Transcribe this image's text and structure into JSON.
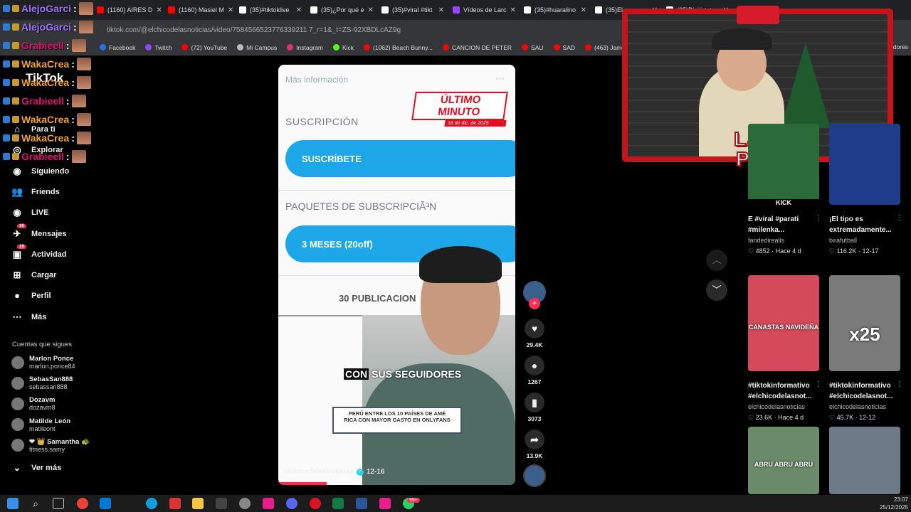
{
  "browser": {
    "tabs": [
      {
        "title": "(1160) AIRES D",
        "color": "#ff0000"
      },
      {
        "title": "(1160) Masiel M",
        "color": "#ff0000"
      },
      {
        "title": "(35)#tiktoklive",
        "color": "#ffffff"
      },
      {
        "title": "(35)¿Por qué e",
        "color": "#ffffff"
      },
      {
        "title": "(35)#viral #tikt",
        "color": "#ffffff"
      },
      {
        "title": "Vídeos de Larc",
        "color": "#9146ff"
      },
      {
        "title": "(35)#huaralino",
        "color": "#ffffff"
      },
      {
        "title": "(35)El...",
        "color": "#ffffff"
      },
      {
        "title": "(35)Diviértete",
        "color": "#ffffff"
      }
    ],
    "url": "tiktok.com/@elchicodelasnoticias/video/7584566523776339211 7_r=1&_t=ZS-92XBDLcAZ9g",
    "bookmarks": [
      {
        "label": "Facebook",
        "color": "#1877f2"
      },
      {
        "label": "Twitch",
        "color": "#9146ff"
      },
      {
        "label": "(72) YouTube",
        "color": "#ff0000"
      },
      {
        "label": "Mi Campus",
        "color": "#bbbbbb"
      },
      {
        "label": "Instagram",
        "color": "#e1306c"
      },
      {
        "label": "Kick",
        "color": "#53fc18"
      },
      {
        "label": "(1062) Beach Bunny...",
        "color": "#ff0000"
      },
      {
        "label": "CANCION DE PETER",
        "color": "#ff0000"
      },
      {
        "label": "SAU",
        "color": "#ff0000"
      },
      {
        "label": "SAD",
        "color": "#ff0000"
      },
      {
        "label": "(463) James Arthur -...",
        "color": "#ff0000"
      }
    ],
    "bookmarks_overflow": "adores"
  },
  "chat": [
    {
      "user": "AlejoGarci",
      "suffix": ":",
      "color": "#a070ff"
    },
    {
      "user": "AlejoGarci",
      "suffix": ":",
      "color": "#a070ff"
    },
    {
      "user": "Grabieell",
      "suffix": ":",
      "color": "#e01070"
    },
    {
      "user": "WakaCrea",
      "suffix": ":",
      "color": "#f0a030"
    },
    {
      "user": "WakaCrea",
      "suffix": ":",
      "color": "#f0a030"
    },
    {
      "user": "Grabieell",
      "suffix": ":",
      "color": "#e01070"
    },
    {
      "user": "WakaCrea",
      "suffix": ":",
      "color": "#f0a030"
    },
    {
      "user": "WakaCrea",
      "suffix": ":",
      "color": "#f0a030"
    },
    {
      "user": "Grabieell",
      "suffix": ":",
      "color": "#e01070"
    }
  ],
  "sidebar": {
    "logo": "TikTok",
    "items": [
      {
        "label": "Para ti",
        "icon": "home-icon"
      },
      {
        "label": "Explorar",
        "icon": "compass-icon"
      },
      {
        "label": "Siguiendo",
        "icon": "following-icon"
      },
      {
        "label": "Friends",
        "icon": "friends-icon"
      },
      {
        "label": "LIVE",
        "icon": "live-icon"
      },
      {
        "label": "Mensajes",
        "icon": "messages-icon",
        "badge": "16"
      },
      {
        "label": "Actividad",
        "icon": "activity-icon",
        "badge": "19"
      },
      {
        "label": "Cargar",
        "icon": "upload-icon"
      },
      {
        "label": "Perfil",
        "icon": "profile-icon"
      },
      {
        "label": "Más",
        "icon": "more-icon"
      }
    ],
    "following_title": "Cuentas que sigues",
    "following": [
      {
        "name": "Marlon Ponce",
        "handle": "marlon.ponce84"
      },
      {
        "name": "SebasSan888",
        "handle": "sebassan888"
      },
      {
        "name": "Dozavm",
        "handle": "dozavm8"
      },
      {
        "name": "Matilde León",
        "handle": "matileont"
      },
      {
        "name": "❤ 👑 Samantha 🐢",
        "handle": "fitness.samy"
      }
    ],
    "see_more": "Ver más"
  },
  "video": {
    "header": "Más información",
    "breaking": "ÚLTIMO MINUTO",
    "breaking_date": "16 de dic. de 2025",
    "section1": "SUSCRIPCIÓN",
    "subscribe_btn": "SUSCRÍBETE",
    "section2": "PAQUETES DE SUBSCRIPCIÃ³N",
    "package_btn": "3 MESES (20off)",
    "posts": "30 PUBLICACION",
    "caption_highlight": "CON",
    "caption_rest": "SUS SEGUIDORES",
    "infobox": "PERÚ ENTRE LOS 10 PAÍSES DE AMÉ RICA CON MAYOR GASTO EN ONLYFANS",
    "author": "elchicodelasnoticias",
    "date": "12-16"
  },
  "actions": {
    "likes": "29.4K",
    "comments": "1267",
    "saves": "3073",
    "shares": "13.9K"
  },
  "stream_overlay": {
    "logo_line1": "LARC",
    "logo_line2": "PLAY"
  },
  "grid": [
    {
      "title": "E #viral #parati #milenka...",
      "author": "fandedirealis",
      "stat": "4852",
      "age": "Hace 4 d",
      "overlay": "KICK"
    },
    {
      "title": "¡El tipo es extremadamente...",
      "author": "birafutball",
      "stat": "116.2K",
      "age": "12-17",
      "overlay": ""
    },
    {
      "title": "#tiktokinformativo #elchicodelasnot...",
      "author": "elchicodelasnoticias",
      "stat": "23.6K",
      "age": "Hace 4 d",
      "overlay": "CANASTAS NAVIDEÑA"
    },
    {
      "title": "#tiktokinformativo #elchicodelasnot...",
      "author": "elchicodelasnoticias",
      "stat": "45.7K",
      "age": "12-12",
      "overlay": "x25"
    },
    {
      "title": "",
      "author": "",
      "stat": "",
      "age": "",
      "overlay": "ABRU ABRU ABRU"
    },
    {
      "title": "",
      "author": "",
      "stat": "",
      "age": "",
      "overlay": ""
    }
  ],
  "taskbar": {
    "time": "23:07",
    "date": "25/12/2025",
    "notif": "99+"
  }
}
